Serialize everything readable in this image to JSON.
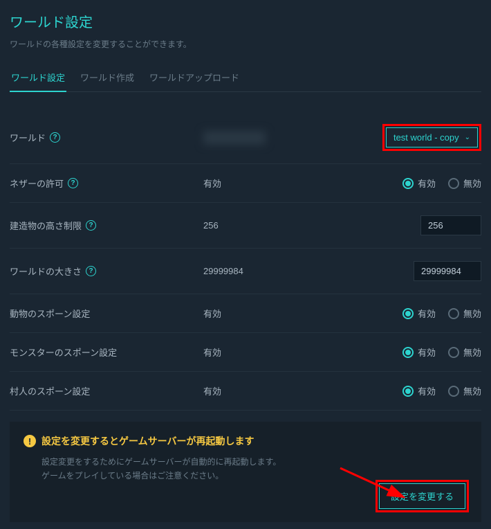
{
  "page": {
    "title": "ワールド設定",
    "description": "ワールドの各種設定を変更することができます。"
  },
  "tabs": [
    {
      "label": "ワールド設定",
      "active": true
    },
    {
      "label": "ワールド作成",
      "active": false
    },
    {
      "label": "ワールドアップロード",
      "active": false
    }
  ],
  "labels": {
    "enabled": "有効",
    "disabled": "無効"
  },
  "rows": {
    "world": {
      "label": "ワールド",
      "selected": "test world - copy"
    },
    "nether": {
      "label": "ネザーの許可",
      "current": "有効",
      "value": "enabled"
    },
    "buildHeight": {
      "label": "建造物の高さ制限",
      "current": "256",
      "value": "256"
    },
    "worldSize": {
      "label": "ワールドの大きさ",
      "current": "29999984",
      "value": "29999984"
    },
    "animalSpawn": {
      "label": "動物のスポーン設定",
      "current": "有効",
      "value": "enabled"
    },
    "monsterSpawn": {
      "label": "モンスターのスポーン設定",
      "current": "有効",
      "value": "enabled"
    },
    "villagerSpawn": {
      "label": "村人のスポーン設定",
      "current": "有効",
      "value": "enabled"
    }
  },
  "warning": {
    "title": "設定を変更するとゲームサーバーが再起動します",
    "line1": "設定変更をするためにゲームサーバーが自動的に再起動します。",
    "line2": "ゲームをプレイしている場合はご注意ください。"
  },
  "submit": {
    "label": "設定を変更する"
  }
}
